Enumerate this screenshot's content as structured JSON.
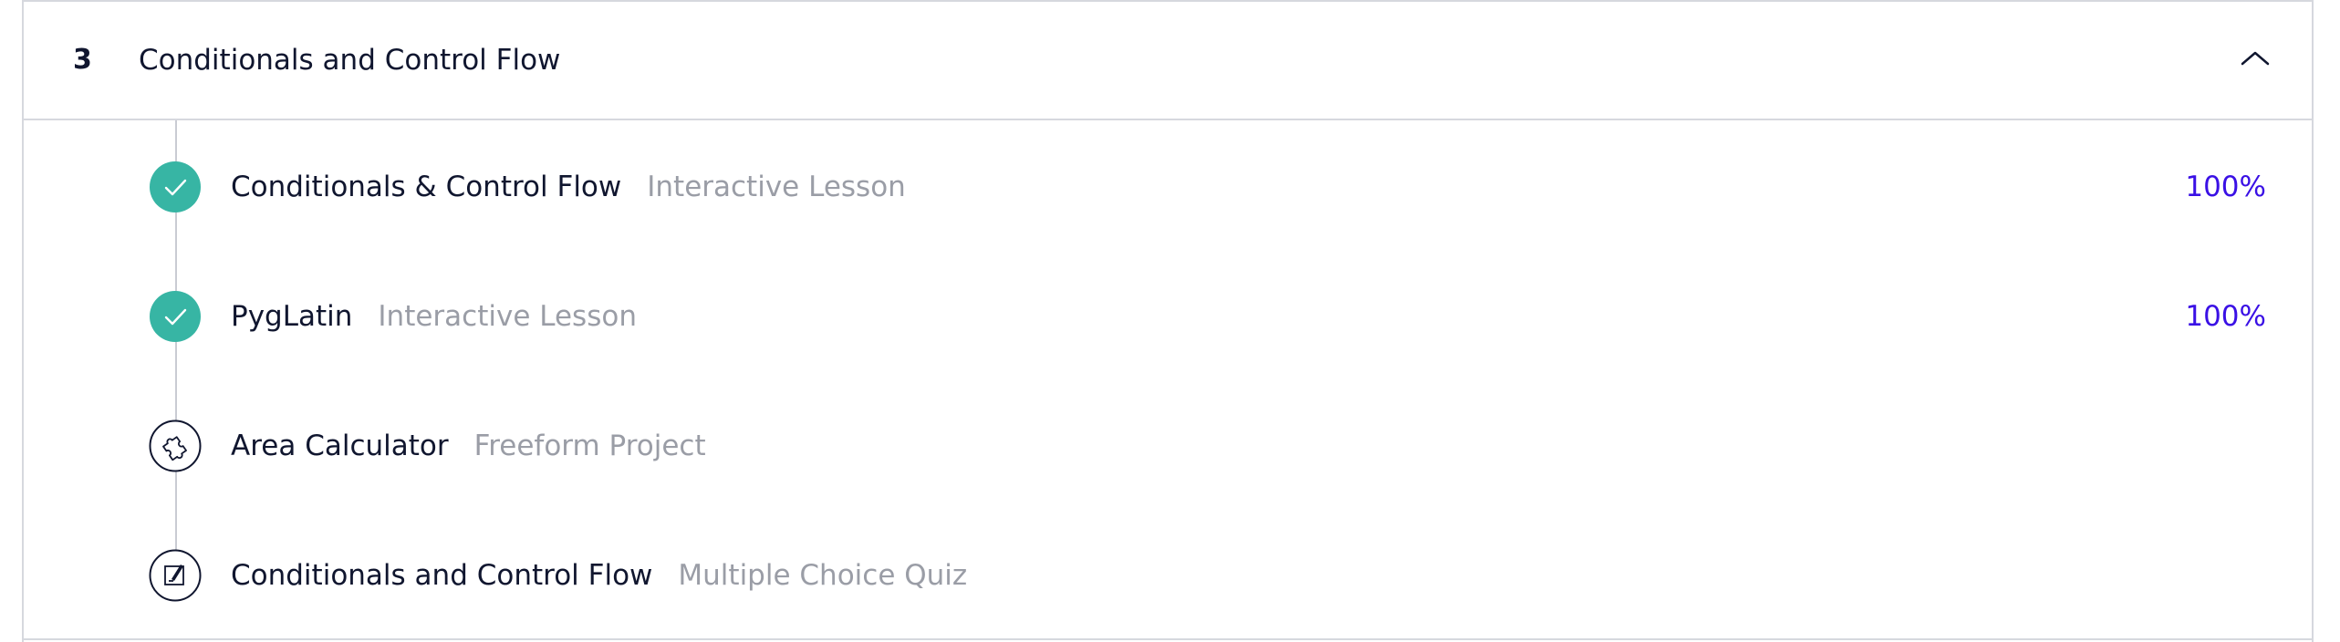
{
  "module": {
    "number": "3",
    "title": "Conditionals and Control Flow",
    "collapse_icon": "chevron-up-icon"
  },
  "items": [
    {
      "title": "Conditionals & Control Flow",
      "type": "Interactive Lesson",
      "progress": "100%",
      "status": "complete",
      "icon": "check-icon"
    },
    {
      "title": "PygLatin",
      "type": "Interactive Lesson",
      "progress": "100%",
      "status": "complete",
      "icon": "check-icon"
    },
    {
      "title": "Area Calculator",
      "type": "Freeform Project",
      "progress": "",
      "status": "not-started",
      "icon": "puzzle-icon"
    },
    {
      "title": "Conditionals and Control Flow",
      "type": "Multiple Choice Quiz",
      "progress": "",
      "status": "not-started",
      "icon": "quiz-icon"
    }
  ],
  "colors": {
    "complete": "#37b5a4",
    "progress_text": "#3a10e5",
    "muted_text": "#9a9da6",
    "primary_text": "#10162f",
    "border": "#d6d8de"
  }
}
